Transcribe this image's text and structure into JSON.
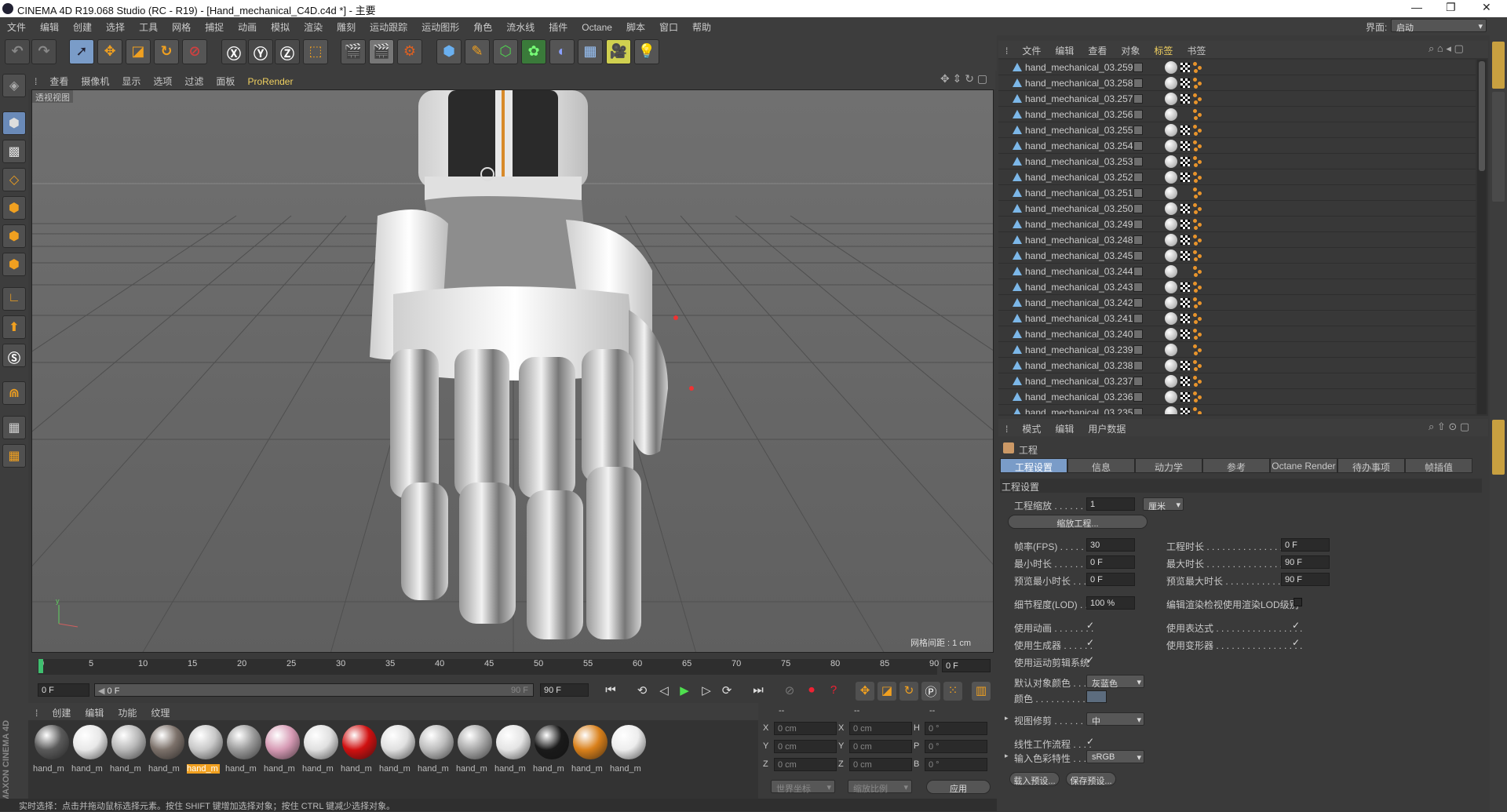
{
  "window": {
    "title": "CINEMA 4D R19.068 Studio (RC - R19) - [Hand_mechanical_C4D.c4d *] - 主要",
    "minimize": "—",
    "restore": "❐",
    "close": "✕"
  },
  "menubar": [
    "文件",
    "编辑",
    "创建",
    "选择",
    "工具",
    "网格",
    "捕捉",
    "动画",
    "模拟",
    "渲染",
    "雕刻",
    "运动跟踪",
    "运动图形",
    "角色",
    "流水线",
    "插件",
    "Octane",
    "脚本",
    "窗口",
    "帮助"
  ],
  "layout": {
    "label": "界面:",
    "value": "启动"
  },
  "viewport": {
    "menu": [
      "查看",
      "摄像机",
      "显示",
      "选项",
      "过滤",
      "面板",
      "ProRender"
    ],
    "name": "透视视图",
    "grid_label": "网格间距 : 1 cm"
  },
  "timeline": {
    "ticks": [
      "0",
      "5",
      "10",
      "15",
      "20",
      "25",
      "30",
      "35",
      "40",
      "45",
      "50",
      "55",
      "60",
      "65",
      "70",
      "75",
      "80",
      "85",
      "90"
    ],
    "current_frame": "0 F"
  },
  "playbar": {
    "start": "0 F",
    "range_start": "0 F",
    "range_end": "90 F",
    "end": "90 F"
  },
  "material_manager": {
    "menu": [
      "创建",
      "编辑",
      "功能",
      "纹理"
    ],
    "materials": [
      {
        "label": "hand_m",
        "color": "#5a5a5a"
      },
      {
        "label": "hand_m",
        "color": "#e8e8e8"
      },
      {
        "label": "hand_m",
        "color": "#b8b8b8"
      },
      {
        "label": "hand_m",
        "color": "#7c716a"
      },
      {
        "label": "hand_m",
        "color": "#c8c8c8",
        "selected": true
      },
      {
        "label": "hand_m",
        "color": "#9a9a9a"
      },
      {
        "label": "hand_m",
        "color": "#d69ab4"
      },
      {
        "label": "hand_m",
        "color": "#e0e0e0"
      },
      {
        "label": "hand_m",
        "color": "#d01010"
      },
      {
        "label": "hand_m",
        "color": "#e0e0e0"
      },
      {
        "label": "hand_m",
        "color": "#bcbcbc"
      },
      {
        "label": "hand_m",
        "color": "#a8a8a8"
      },
      {
        "label": "hand_m",
        "color": "#e4e4e4"
      },
      {
        "label": "hand_m",
        "color": "#1a1a1a"
      },
      {
        "label": "hand_m",
        "color": "#d9801a"
      },
      {
        "label": "hand_m",
        "color": "#ededed"
      }
    ]
  },
  "coords": {
    "headers": [
      "--",
      "--",
      "--"
    ],
    "rows": [
      {
        "a": "X",
        "av": "0 cm",
        "b": "X",
        "bv": "0 cm",
        "c": "H",
        "cv": "0 °"
      },
      {
        "a": "Y",
        "av": "0 cm",
        "b": "Y",
        "bv": "0 cm",
        "c": "P",
        "cv": "0 °"
      },
      {
        "a": "Z",
        "av": "0 cm",
        "b": "Z",
        "bv": "0 cm",
        "c": "B",
        "cv": "0 °"
      }
    ],
    "world": "世界坐标",
    "scale": "缩放比例",
    "apply": "应用"
  },
  "status": "实时选择：点击并拖动鼠标选择元素。按住 SHIFT 键增加选择对象；按住 CTRL 键减少选择对象。",
  "object_manager": {
    "menu": [
      "文件",
      "编辑",
      "查看",
      "对象",
      "标签",
      "书签"
    ],
    "objects": [
      "hand_mechanical_03.259",
      "hand_mechanical_03.258",
      "hand_mechanical_03.257",
      "hand_mechanical_03.256",
      "hand_mechanical_03.255",
      "hand_mechanical_03.254",
      "hand_mechanical_03.253",
      "hand_mechanical_03.252",
      "hand_mechanical_03.251",
      "hand_mechanical_03.250",
      "hand_mechanical_03.249",
      "hand_mechanical_03.248",
      "hand_mechanical_03.245",
      "hand_mechanical_03.244",
      "hand_mechanical_03.243",
      "hand_mechanical_03.242",
      "hand_mechanical_03.241",
      "hand_mechanical_03.240",
      "hand_mechanical_03.239",
      "hand_mechanical_03.238",
      "hand_mechanical_03.237",
      "hand_mechanical_03.236",
      "hand_mechanical_03.235"
    ]
  },
  "attributes": {
    "menu": [
      "模式",
      "编辑",
      "用户数据"
    ],
    "header": "工程",
    "tabs": [
      "工程设置",
      "信息",
      "动力学",
      "参考",
      "Octane Render",
      "待办事项",
      "帧插值"
    ],
    "section": "工程设置",
    "scale_label": "工程缩放 . . . . . . . .",
    "scale_value": "1",
    "scale_unit": "厘米",
    "scale_button": "缩放工程...",
    "fps_label": "帧率(FPS) . . . . . . .",
    "fps": "30",
    "len_label": "工程时长 . . . . . . . . . . . . . . . . . .",
    "len": "0 F",
    "min_label": "最小时长 . . . . . . . .",
    "min": "0 F",
    "max_label": "最大时长 . . . . . . . . . . . . . . . . . .",
    "max": "90 F",
    "pmin_label": "预览最小时长 . . . .",
    "pmin": "0 F",
    "pmax_label": "预览最大时长 . . . . . . . . . . . . . .",
    "pmax": "90 F",
    "lod_label": "细节程度(LOD) . . . .",
    "lod": "100 %",
    "lod_render": "编辑渲染检视使用渲染LOD级别",
    "anim": "使用动画 . . . . . . . .",
    "expr": "使用表达式 . . . . . . . . . . . . . . . . .",
    "gen": "使用生成器 . . . . . .",
    "deform": "使用变形器 . . . . . . . . . . . . . . . . .",
    "motion": "使用运动剪辑系统",
    "objcolor_label": "默认对象颜色 . . . .",
    "objcolor": "灰蓝色",
    "color_label": "颜色 . . . . . . . . . . . .",
    "clip_label": "视图修剪 . . . . . . . .",
    "clip": "中",
    "linear": "线性工作流程 . . . .",
    "profile_label": "输入色彩特性 . . . .",
    "profile": "sRGB",
    "load_preset": "载入预设...",
    "save_preset": "保存预设..."
  },
  "check": "✓",
  "maxon": "MAXON CINEMA 4D"
}
